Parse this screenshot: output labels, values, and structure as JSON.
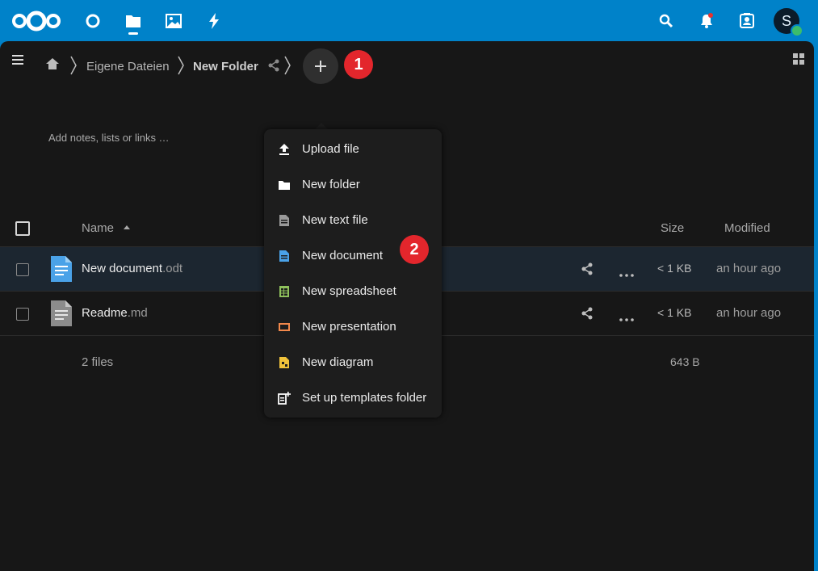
{
  "header": {
    "apps": [
      "dashboard",
      "files",
      "photos",
      "activity"
    ],
    "active_app": "files",
    "avatar_initial": "S"
  },
  "breadcrumb": {
    "items": [
      "Eigene Dateien",
      "New Folder"
    ]
  },
  "notes_placeholder": "Add notes, lists or links …",
  "table": {
    "col_name": "Name",
    "col_size": "Size",
    "col_modified": "Modified",
    "rows": [
      {
        "basename": "New document",
        "ext": ".odt",
        "size": "< 1 KB",
        "modified": "an hour ago",
        "icon": "document-icon"
      },
      {
        "basename": "Readme",
        "ext": ".md",
        "size": "< 1 KB",
        "modified": "an hour ago",
        "icon": "text-file-icon"
      }
    ],
    "summary_count": "2 files",
    "summary_size": "643 B"
  },
  "markers": [
    "1",
    "2"
  ],
  "new_menu": {
    "items": [
      {
        "label": "Upload file",
        "icon": "upload-icon"
      },
      {
        "label": "New folder",
        "icon": "folder-icon"
      },
      {
        "label": "New text file",
        "icon": "text-file-icon"
      },
      {
        "label": "New document",
        "icon": "document-icon"
      },
      {
        "label": "New spreadsheet",
        "icon": "spreadsheet-icon"
      },
      {
        "label": "New presentation",
        "icon": "presentation-icon"
      },
      {
        "label": "New diagram",
        "icon": "diagram-icon"
      },
      {
        "label": "Set up templates folder",
        "icon": "templates-icon"
      }
    ]
  },
  "colors": {
    "brand": "#0082c9",
    "background": "#171717",
    "menu_bg": "#1d1d1d",
    "marker": "#e3262c",
    "document": "#4aa2e8",
    "spreadsheet": "#8fc15c",
    "presentation": "#f2884b",
    "diagram": "#f1c33b"
  }
}
